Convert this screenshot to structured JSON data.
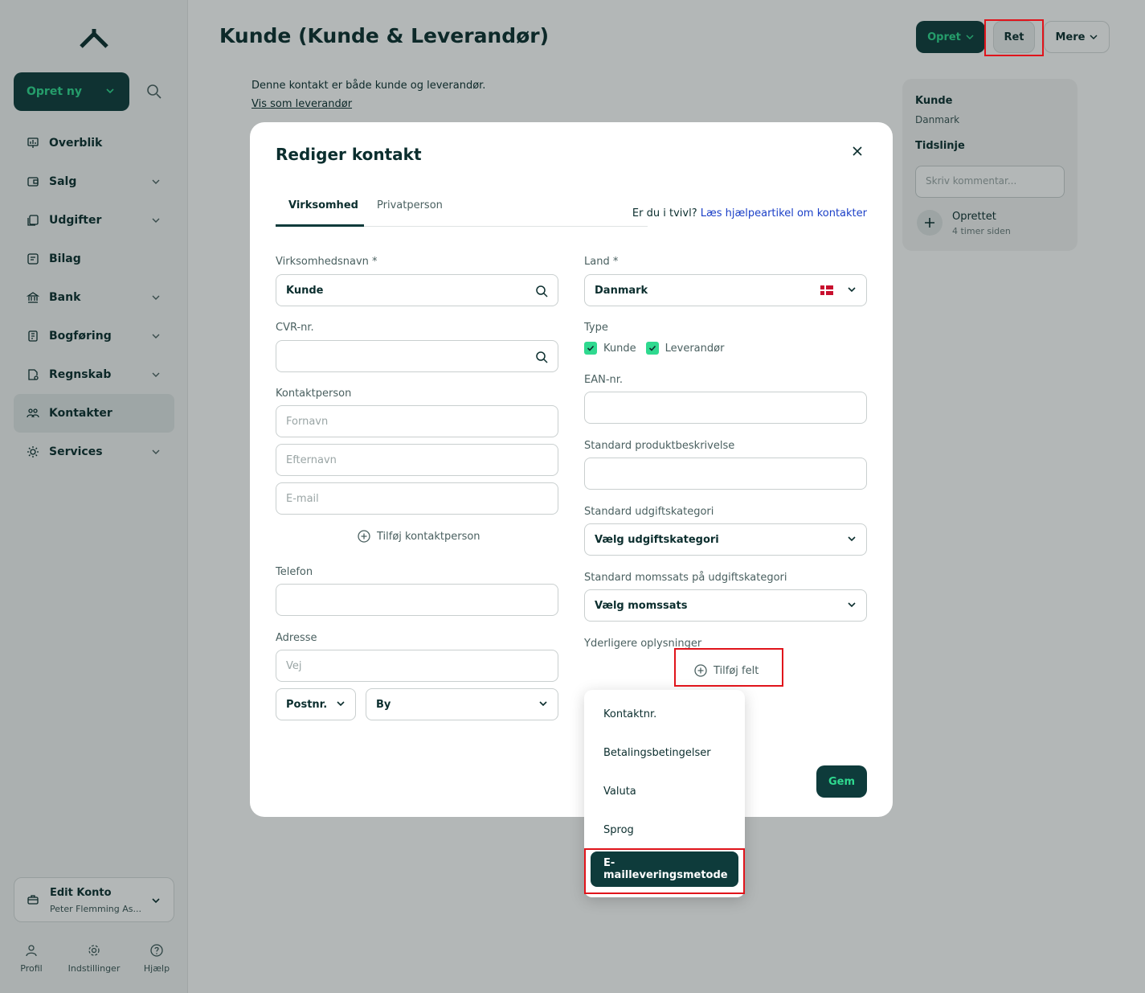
{
  "sidebar": {
    "create_label": "Opret ny",
    "items": [
      {
        "label": "Overblik",
        "icon": "chart-icon",
        "chevron": false
      },
      {
        "label": "Salg",
        "icon": "invoice-icon",
        "chevron": true
      },
      {
        "label": "Udgifter",
        "icon": "receipt-icon",
        "chevron": true
      },
      {
        "label": "Bilag",
        "icon": "document-icon",
        "chevron": false
      },
      {
        "label": "Bank",
        "icon": "bank-icon",
        "chevron": true
      },
      {
        "label": "Bogføring",
        "icon": "ledger-icon",
        "chevron": true
      },
      {
        "label": "Regnskab",
        "icon": "report-icon",
        "chevron": true
      },
      {
        "label": "Kontakter",
        "icon": "people-icon",
        "chevron": false,
        "active": true
      },
      {
        "label": "Services",
        "icon": "services-icon",
        "chevron": true
      }
    ],
    "account": {
      "name": "Edit Konto",
      "sub": "Peter Flemming As..."
    },
    "bottom": [
      {
        "label": "Profil",
        "icon": "user-icon"
      },
      {
        "label": "Indstillinger",
        "icon": "gear-icon"
      },
      {
        "label": "Hjælp",
        "icon": "help-icon"
      }
    ]
  },
  "header": {
    "title": "Kunde (Kunde & Leverandør)",
    "btn_create": "Opret",
    "btn_edit": "Ret",
    "btn_more": "Mere"
  },
  "intro": {
    "text": "Denne kontakt er både kunde og leverandør.",
    "link": "Vis som leverandør"
  },
  "side_panel": {
    "title": "Kunde",
    "country": "Danmark",
    "timeline": "Tidslinje",
    "comment_placeholder": "Skriv kommentar...",
    "event": "Oprettet",
    "event_time": "4 timer siden"
  },
  "modal": {
    "title": "Rediger kontakt",
    "tabs": [
      "Virksomhed",
      "Privatperson"
    ],
    "help_prefix": "Er du i tvivl?",
    "help_link": "Læs hjælpeartikel om kontakter",
    "company_label": "Virksomhedsnavn *",
    "company_value": "Kunde",
    "cvr_label": "CVR-nr.",
    "contact_label": "Kontaktperson",
    "firstname_ph": "Fornavn",
    "lastname_ph": "Efternavn",
    "email_ph": "E-mail",
    "add_contact": "Tilføj kontaktperson",
    "phone_label": "Telefon",
    "address_label": "Adresse",
    "street_ph": "Vej",
    "zip": "Postnr.",
    "city": "By",
    "country_label": "Land *",
    "country_value": "Danmark",
    "type_label": "Type",
    "type_customer": "Kunde",
    "type_supplier": "Leverandør",
    "ean_label": "EAN-nr.",
    "product_desc_label": "Standard produktbeskrivelse",
    "expense_cat_label": "Standard udgiftskategori",
    "expense_cat_value": "Vælg udgiftskategori",
    "vat_label": "Standard momssats på udgiftskategori",
    "vat_value": "Vælg momssats",
    "extra_label": "Yderligere oplysninger",
    "add_field": "Tilføj felt",
    "save": "Gem"
  },
  "menu": {
    "items": [
      "Kontaktnr.",
      "Betalingsbetingelser",
      "Valuta",
      "Sprog",
      "E-mailleveringsmetode"
    ],
    "selected": "E-mailleveringsmetode"
  },
  "colors": {
    "brand_dark": "#0e3b3b",
    "brand_green": "#2fd98f",
    "highlight_red": "#e0141b",
    "link_blue": "#1a3fc7"
  }
}
